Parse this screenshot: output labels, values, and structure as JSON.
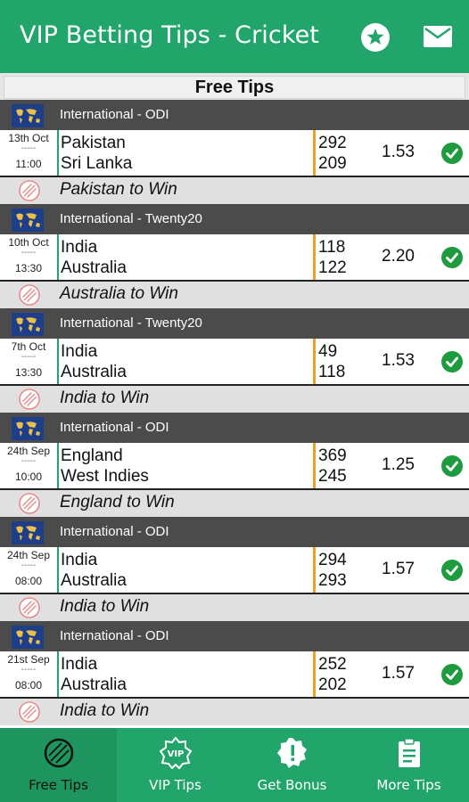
{
  "appbar": {
    "title": "VIP Betting Tips - Cricket",
    "star_icon": "star-icon",
    "mail_icon": "mail-icon"
  },
  "section": {
    "title": "Free Tips"
  },
  "colors": {
    "primary": "#22a56b",
    "header_dark": "#4b4b4b",
    "orange": "#f0a020",
    "tip_bg": "#e0e0e0"
  },
  "tips": [
    {
      "league": "International - ODI",
      "date": "13th Oct",
      "sep": "-----",
      "time": "11:00",
      "team1": "Pakistan",
      "team2": "Sri Lanka",
      "score1": "292",
      "score2": "209",
      "odds": "1.53",
      "tip": "Pakistan to Win"
    },
    {
      "league": "International - Twenty20",
      "date": "10th Oct",
      "sep": "-----",
      "time": "13:30",
      "team1": "India",
      "team2": "Australia",
      "score1": "118",
      "score2": "122",
      "odds": "2.20",
      "tip": "Australia to Win"
    },
    {
      "league": "International - Twenty20",
      "date": "7th Oct",
      "sep": "-----",
      "time": "13:30",
      "team1": "India",
      "team2": "Australia",
      "score1": "49",
      "score2": "118",
      "odds": "1.53",
      "tip": "India to Win"
    },
    {
      "league": "International - ODI",
      "date": "24th Sep",
      "sep": "-----",
      "time": "10:00",
      "team1": "England",
      "team2": "West Indies",
      "score1": "369",
      "score2": "245",
      "odds": "1.25",
      "tip": "England to Win"
    },
    {
      "league": "International - ODI",
      "date": "24th Sep",
      "sep": "-----",
      "time": "08:00",
      "team1": "India",
      "team2": "Australia",
      "score1": "294",
      "score2": "293",
      "odds": "1.57",
      "tip": "India to Win"
    },
    {
      "league": "International - ODI",
      "date": "21st Sep",
      "sep": "-----",
      "time": "08:00",
      "team1": "India",
      "team2": "Australia",
      "score1": "252",
      "score2": "202",
      "odds": "1.57",
      "tip": "India to Win"
    }
  ],
  "nav": [
    {
      "label": "Free Tips",
      "icon": "cricket-ball-icon",
      "active": true
    },
    {
      "label": "VIP Tips",
      "icon": "vip-badge-icon",
      "active": false
    },
    {
      "label": "Get Bonus",
      "icon": "alert-badge-icon",
      "active": false
    },
    {
      "label": "More Tips",
      "icon": "clipboard-icon",
      "active": false
    }
  ]
}
